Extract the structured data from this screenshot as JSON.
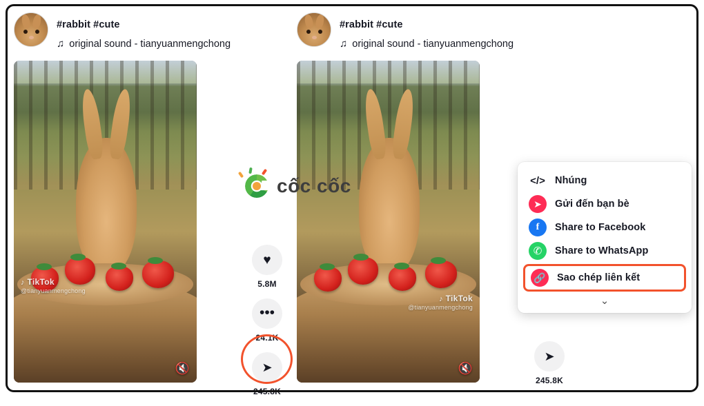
{
  "posts": [
    {
      "hashtags": "#rabbit #cute",
      "sound": "original sound - tianyuanmengchong",
      "sound_note": "♫",
      "watermark": "TikTok",
      "watermark_handle": "@tianyuanmengchong",
      "mute_label": "🔇",
      "actions": [
        {
          "icon": "heart-icon",
          "glyph": "♥",
          "count": "5.8M"
        },
        {
          "icon": "comment-icon",
          "glyph": "•••",
          "count": "24.1K"
        },
        {
          "icon": "share-icon",
          "glyph": "➤",
          "count": "245.8K"
        }
      ]
    },
    {
      "hashtags": "#rabbit #cute",
      "sound": "original sound - tianyuanmengchong",
      "sound_note": "♫",
      "watermark": "TikTok",
      "watermark_handle": "@tianyuanmengchong",
      "mute_label": "🔇",
      "actions": [
        {
          "icon": "share-icon",
          "glyph": "➤",
          "count": "245.8K"
        }
      ]
    }
  ],
  "brand": {
    "name": "cốc cốc",
    "mark": "coccoc-logo-icon"
  },
  "share_menu": {
    "items": [
      {
        "label": "Nhúng",
        "icon": "embed-code-icon",
        "glyph": "</>",
        "highlighted": false
      },
      {
        "label": "Gửi đến bạn bè",
        "icon": "send-to-friends-icon",
        "glyph": "➤",
        "highlighted": false
      },
      {
        "label": "Share to Facebook",
        "icon": "facebook-icon",
        "glyph": "f",
        "highlighted": false
      },
      {
        "label": "Share to WhatsApp",
        "icon": "whatsapp-icon",
        "glyph": "✆",
        "highlighted": false
      },
      {
        "label": "Sao chép liên kết",
        "icon": "copy-link-icon",
        "glyph": "🔗",
        "highlighted": true
      }
    ],
    "expand_glyph": "⌄"
  },
  "colors": {
    "highlight": "#f2522c",
    "tiktok_red": "#fe2c55",
    "facebook_blue": "#1877f2",
    "whatsapp_green": "#25d366",
    "text": "#161823"
  }
}
